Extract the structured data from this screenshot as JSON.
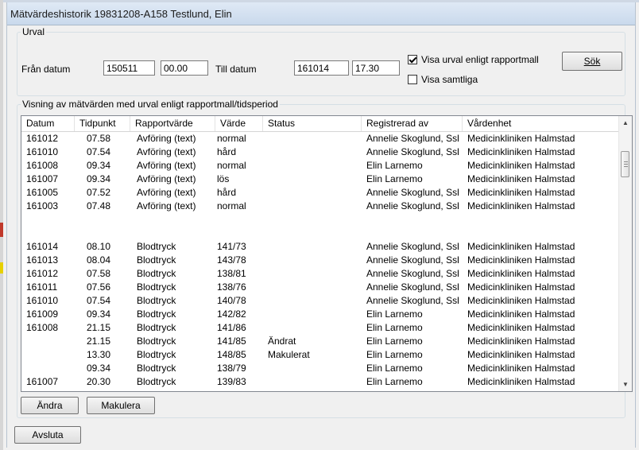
{
  "window": {
    "title": "Mätvärdeshistorik 19831208-A158 Testlund, Elin"
  },
  "urval": {
    "legend": "Urval",
    "from_label": "Från datum",
    "from_date": "150511",
    "from_time": "00.00",
    "to_label": "Till datum",
    "to_date": "161014",
    "to_time": "17.30",
    "checkbox_report": "Visa urval enligt rapportmall",
    "checkbox_report_checked": true,
    "checkbox_all": "Visa samtliga",
    "checkbox_all_checked": false,
    "search_button": "Sök"
  },
  "listing": {
    "legend": "Visning av mätvärden med urval enligt rapportmall/tidsperiod",
    "columns": [
      "Datum",
      "Tidpunkt",
      "Rapportvärde",
      "Värde",
      "Status",
      "Registrerad av",
      "Vårdenhet"
    ],
    "rows": [
      [
        "161012",
        "07.58",
        "Avföring (text)",
        "normal",
        "",
        "Annelie Skoglund, Ssl",
        "Medicinkliniken Halmstad"
      ],
      [
        "161010",
        "07.54",
        "Avföring (text)",
        "hård",
        "",
        "Annelie Skoglund, Ssl",
        "Medicinkliniken Halmstad"
      ],
      [
        "161008",
        "09.34",
        "Avföring (text)",
        "normal",
        "",
        "Elin Larnemo",
        "Medicinkliniken Halmstad"
      ],
      [
        "161007",
        "09.34",
        "Avföring (text)",
        "lös",
        "",
        "Elin Larnemo",
        "Medicinkliniken Halmstad"
      ],
      [
        "161005",
        "07.52",
        "Avföring (text)",
        "hård",
        "",
        "Annelie Skoglund, Ssl",
        "Medicinkliniken Halmstad"
      ],
      [
        "161003",
        "07.48",
        "Avföring (text)",
        "normal",
        "",
        "Annelie Skoglund, Ssl",
        "Medicinkliniken Halmstad"
      ],
      [
        "",
        "",
        "",
        "",
        "",
        "",
        ""
      ],
      [
        "",
        "",
        "",
        "",
        "",
        "",
        ""
      ],
      [
        "161014",
        "08.10",
        "Blodtryck",
        "141/73",
        "",
        "Annelie Skoglund, Ssl",
        "Medicinkliniken Halmstad"
      ],
      [
        "161013",
        "08.04",
        "Blodtryck",
        "143/78",
        "",
        "Annelie Skoglund, Ssl",
        "Medicinkliniken Halmstad"
      ],
      [
        "161012",
        "07.58",
        "Blodtryck",
        "138/81",
        "",
        "Annelie Skoglund, Ssl",
        "Medicinkliniken Halmstad"
      ],
      [
        "161011",
        "07.56",
        "Blodtryck",
        "138/76",
        "",
        "Annelie Skoglund, Ssl",
        "Medicinkliniken Halmstad"
      ],
      [
        "161010",
        "07.54",
        "Blodtryck",
        "140/78",
        "",
        "Annelie Skoglund, Ssl",
        "Medicinkliniken Halmstad"
      ],
      [
        "161009",
        "09.34",
        "Blodtryck",
        "142/82",
        "",
        "Elin Larnemo",
        "Medicinkliniken Halmstad"
      ],
      [
        "161008",
        "21.15",
        "Blodtryck",
        "141/86",
        "",
        "Elin Larnemo",
        "Medicinkliniken Halmstad"
      ],
      [
        "",
        "21.15",
        "Blodtryck",
        "141/85",
        "Ändrat",
        "Elin Larnemo",
        "Medicinkliniken Halmstad"
      ],
      [
        "",
        "13.30",
        "Blodtryck",
        "148/85",
        "Makulerat",
        "Elin Larnemo",
        "Medicinkliniken Halmstad"
      ],
      [
        "",
        "09.34",
        "Blodtryck",
        "138/79",
        "",
        "Elin Larnemo",
        "Medicinkliniken Halmstad"
      ],
      [
        "161007",
        "20.30",
        "Blodtryck",
        "139/83",
        "",
        "Elin Larnemo",
        "Medicinkliniken Halmstad"
      ]
    ],
    "edit_button": "Ändra",
    "void_button": "Makulera"
  },
  "footer": {
    "exit_button": "Avsluta"
  },
  "icons": {
    "checkbox_mark": "check-icon",
    "scroll_up": "arrow-up-icon",
    "scroll_down": "arrow-down-icon",
    "scroll_thumb": "scroll-thumb"
  }
}
